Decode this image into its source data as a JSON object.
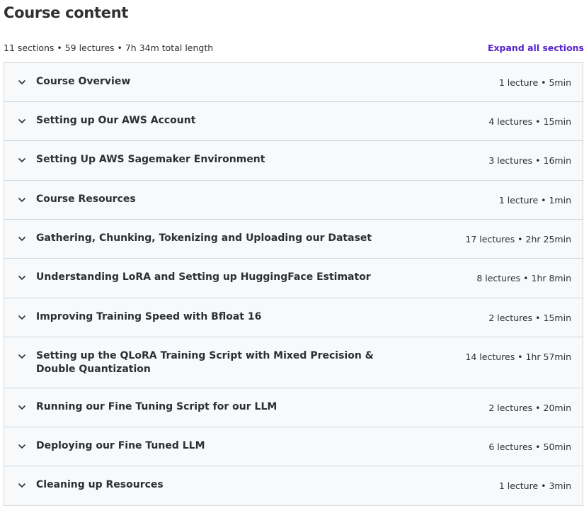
{
  "header": {
    "title": "Course content",
    "summary": "11 sections • 59 lectures • 7h 34m total length",
    "expand_label": "Expand all sections"
  },
  "colors": {
    "accent": "#5624d0",
    "row_bg": "#f7f9fa",
    "border": "#d1d7dc",
    "text": "#2d2f31"
  },
  "sections": [
    {
      "title": "Course Overview",
      "meta": "1 lecture • 5min",
      "icon": "chevron-down-icon"
    },
    {
      "title": "Setting up Our AWS Account",
      "meta": "4 lectures • 15min",
      "icon": "chevron-down-icon"
    },
    {
      "title": "Setting Up AWS Sagemaker Environment",
      "meta": "3 lectures • 16min",
      "icon": "chevron-down-icon"
    },
    {
      "title": "Course Resources",
      "meta": "1 lecture • 1min",
      "icon": "chevron-down-icon"
    },
    {
      "title": "Gathering, Chunking, Tokenizing and Uploading our Dataset",
      "meta": "17 lectures • 2hr 25min",
      "icon": "chevron-down-icon"
    },
    {
      "title": "Understanding LoRA and Setting up HuggingFace Estimator",
      "meta": "8 lectures • 1hr 8min",
      "icon": "chevron-down-icon"
    },
    {
      "title": "Improving Training Speed with Bfloat 16",
      "meta": "2 lectures • 15min",
      "icon": "chevron-down-icon"
    },
    {
      "title": "Setting up the QLoRA Training Script with Mixed Precision & Double Quantization",
      "meta": "14 lectures • 1hr 57min",
      "icon": "chevron-down-icon"
    },
    {
      "title": "Running our Fine Tuning Script for our LLM",
      "meta": "2 lectures • 20min",
      "icon": "chevron-down-icon"
    },
    {
      "title": "Deploying our Fine Tuned LLM",
      "meta": "6 lectures • 50min",
      "icon": "chevron-down-icon"
    },
    {
      "title": "Cleaning up Resources",
      "meta": "1 lecture • 3min",
      "icon": "chevron-down-icon"
    }
  ]
}
